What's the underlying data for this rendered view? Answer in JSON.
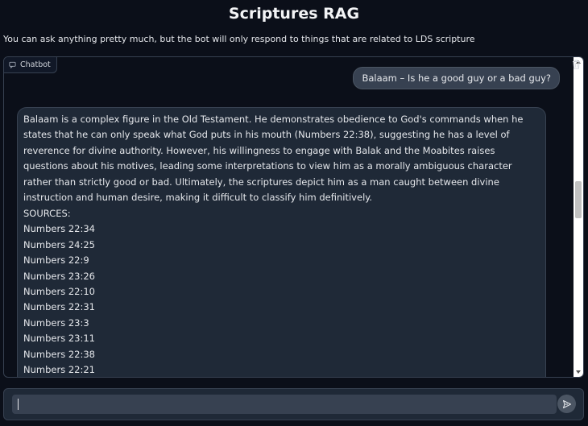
{
  "header": {
    "title": "Scriptures RAG",
    "subtitle": "You can ask anything pretty much, but the bot will only respond to things that are related to LDS scripture"
  },
  "chatbot": {
    "label": "Chatbot",
    "label_icon": "chat-icon",
    "clear_icon": "trash-icon",
    "messages": [
      {
        "role": "user",
        "text": "Balaam – Is he a good guy or a bad guy?"
      },
      {
        "role": "bot",
        "text": "Balaam is a complex figure in the Old Testament. He demonstrates obedience to God's commands when he states that he can only speak what God puts in his mouth (Numbers 22:38), suggesting he has a level of reverence for divine authority. However, his willingness to engage with Balak and the Moabites raises questions about his motives, leading some interpretations to view him as a morally ambiguous character rather than strictly good or bad. Ultimately, the scriptures depict him as a man caught between divine instruction and human desire, making it difficult to classify him definitively.",
        "sources_label": "SOURCES:",
        "sources": [
          "Numbers 22:34",
          "Numbers 24:25",
          "Numbers 22:9",
          "Numbers 23:26",
          "Numbers 22:10",
          "Numbers 22:31",
          "Numbers 23:3",
          "Numbers 23:11",
          "Numbers 22:38",
          "Numbers 22:21"
        ]
      }
    ]
  },
  "input": {
    "value": "",
    "placeholder": "",
    "send_icon": "send-icon"
  },
  "colors": {
    "background": "#0b0f19",
    "panel": "#1f2937",
    "border": "#374151",
    "user_bubble": "#374151"
  }
}
